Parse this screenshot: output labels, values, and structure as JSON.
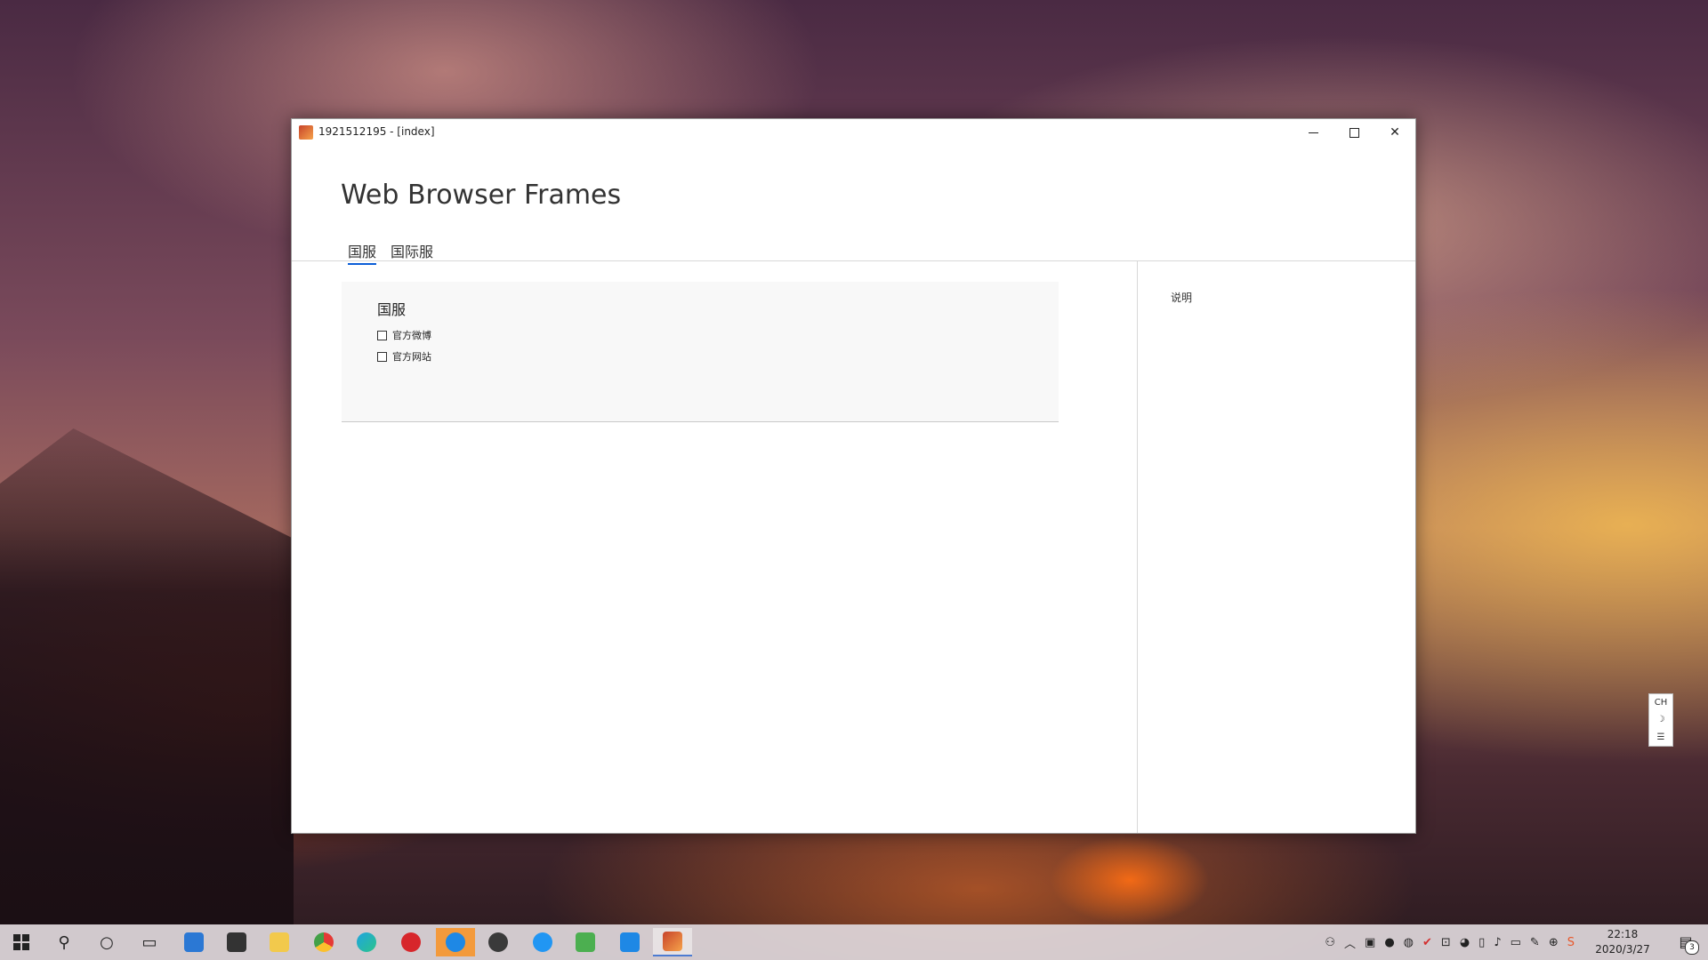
{
  "window": {
    "title": "1921512195 - [index]",
    "minimize": "minimize",
    "maximize": "maximize",
    "close": "✕"
  },
  "page": {
    "title": "Web Browser Frames",
    "tabs": [
      {
        "label": "国服",
        "active": true
      },
      {
        "label": "国际服",
        "active": false
      }
    ]
  },
  "card": {
    "title": "国服",
    "items": [
      {
        "label": "官方微博",
        "checked": false
      },
      {
        "label": "官方网站",
        "checked": false
      }
    ]
  },
  "sidebar": {
    "title": "说明"
  },
  "ime": {
    "lang": "CH",
    "moon": "☽",
    "menu": "☰"
  },
  "taskbar": {
    "start_icon": "windows-logo",
    "search_icon": "⚲",
    "cortana_icon": "○",
    "taskview_icon": "▭",
    "clock_time": "22:18",
    "clock_date": "2020/3/27",
    "notification_count": "3"
  },
  "colors": {
    "accent": "#0b5ed7",
    "card_bg": "#f8f8f8",
    "taskbar_highlight": "#f39a3c"
  }
}
